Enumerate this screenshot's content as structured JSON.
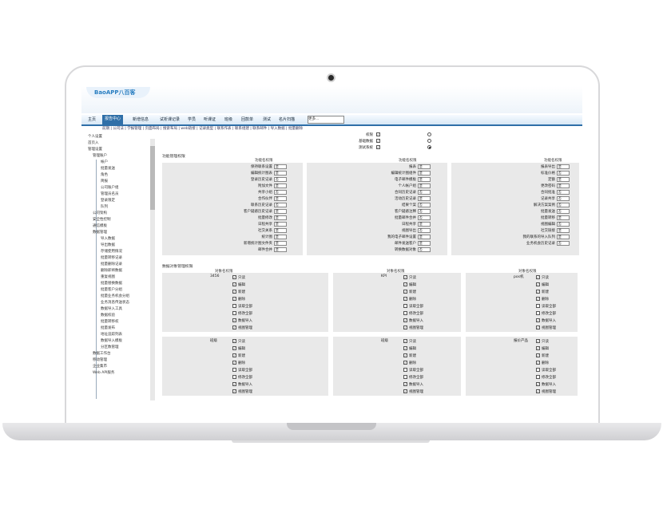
{
  "brand": {
    "logo": "BaoAPP八百客"
  },
  "nav": {
    "items": [
      "主页",
      "报告中心",
      "新增信息",
      "试析课记录",
      "学员",
      "听课证",
      "班级",
      "回款单",
      "测试",
      "名片扫描"
    ],
    "active": "报告中心",
    "more_select": "更多..."
  },
  "subnav": "前期 | 公司法 | 学报管理 | 页面布局 | 搜索布局 | web链接 | 记录类型 | 联系作表 | 联系组建 | 联系邮件 | 导入数据 | 批量删除",
  "sidebar": {
    "items": [
      "个人设置",
      "首页入",
      "管理设置",
      "管理账户",
      "帐户",
      "批量发送",
      "角色",
      "简报",
      "公司账户组",
      "管理员名员",
      "登录限定",
      "队列",
      "公司架构",
      "安全性控制",
      "通信模板",
      "数据管理",
      "导入数据",
      "导出数据",
      "存储使用情况",
      "批量转移记录",
      "批量删除记录",
      "删除即将数据",
      "重复视图",
      "批量替换数据",
      "批量客户分组",
      "批量业务机会分组",
      "业务消息传送状态",
      "数据导入工具",
      "数据校验",
      "批量转移权",
      "批量发布",
      "地址追踪列表",
      "数据导入模板",
      "分区数管理",
      "数据工作台",
      "移动管理",
      "企业集市",
      "Web API服务"
    ]
  },
  "top_rows": [
    {
      "label": "权限",
      "checked": true
    },
    {
      "label": "基础数据",
      "checked": true
    },
    {
      "label": "测试系统",
      "checked": true
    }
  ],
  "function_section": {
    "title": "功能管理权限",
    "col_head": "功能名权限",
    "col1": [
      [
        "保持联系设置",
        "是"
      ],
      [
        "编辑统计图表",
        "是"
      ],
      [
        "登录历史记录",
        "否"
      ],
      [
        "附加文件",
        "是"
      ],
      [
        "共享小组",
        "否"
      ],
      [
        "合作伙伴",
        "是"
      ],
      [
        "联系历史记录",
        "否"
      ],
      [
        "客户疑惑历史记录",
        "是"
      ],
      [
        "批量修改",
        "是"
      ],
      [
        "日程共享",
        "是"
      ],
      [
        "社交关系",
        "是"
      ],
      [
        "统计图",
        "是"
      ],
      [
        "新增统计图文件夹",
        "是"
      ],
      [
        "邮件合并",
        "是"
      ]
    ],
    "col2": [
      [
        "报表",
        "是"
      ],
      [
        "编辑统计图组件",
        "是"
      ],
      [
        "电子邮件模板",
        "是"
      ],
      [
        "个人帐户组",
        "是"
      ],
      [
        "合同历史记录",
        "否"
      ],
      [
        "活动历史记录",
        "是"
      ],
      [
        "结果个案",
        "否"
      ],
      [
        "客户疑惑注释",
        "否"
      ],
      [
        "批量邮件合并",
        "否"
      ],
      [
        "日程共享",
        "是"
      ],
      [
        "视图导出",
        "否"
      ],
      [
        "我的电子邮件设置",
        "是"
      ],
      [
        "邮件发送客户",
        "是"
      ],
      [
        "转换数据对象",
        "否"
      ]
    ],
    "col3": [
      [
        "报表导出",
        "是"
      ],
      [
        "标准价格",
        "否"
      ],
      [
        "定额",
        "是"
      ],
      [
        "更改密码",
        "是"
      ],
      [
        "合同批准",
        "否"
      ],
      [
        "记录共享",
        "否"
      ],
      [
        "解决方案案例",
        "否"
      ],
      [
        "批量发送",
        "否"
      ],
      [
        "批量转移",
        "是"
      ],
      [
        "视图编辑",
        "否"
      ],
      [
        "社交链接",
        "是"
      ],
      [
        "我的联系的导入队列",
        "是"
      ],
      [
        "业务机会历史记录",
        "否"
      ]
    ]
  },
  "data_section": {
    "title": "数据对象管理权限",
    "col_head": "对象名权限",
    "options": [
      "只读",
      "编辑",
      "新建",
      "删除",
      "读取全部",
      "修改全部",
      "数据导入",
      "视图管理"
    ],
    "options_checked": [
      true,
      true,
      true,
      true,
      false,
      false,
      true,
      true
    ],
    "objects": [
      [
        "3456",
        "KPI",
        "pos机"
      ],
      [
        "班级",
        "班级",
        "报价产品"
      ]
    ]
  }
}
